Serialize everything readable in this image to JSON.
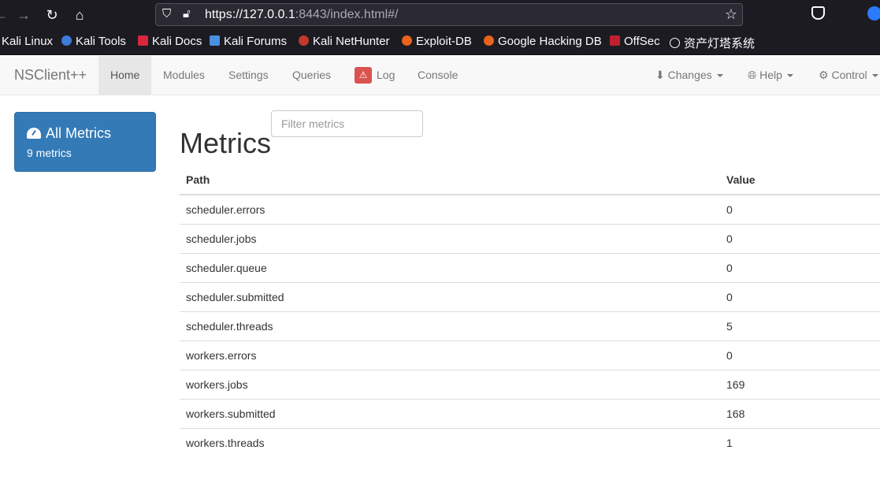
{
  "browser": {
    "url_host": "https://127.0.0.1",
    "url_rest": ":8443/index.html#/",
    "bookmarks": [
      "Kali Linux",
      "Kali Tools",
      "Kali Docs",
      "Kali Forums",
      "Kali NetHunter",
      "Exploit-DB",
      "Google Hacking DB",
      "OffSec",
      "资产灯塔系统"
    ]
  },
  "navbar": {
    "brand": "NSClient++",
    "items": [
      "Home",
      "Modules",
      "Settings",
      "Queries",
      "Log",
      "Console"
    ],
    "active": "Home",
    "right_items": [
      "Changes",
      "Help",
      "Control"
    ]
  },
  "sidebar": {
    "title": "All Metrics",
    "subtitle": "9 metrics"
  },
  "filter": {
    "placeholder": "Filter metrics"
  },
  "main": {
    "title": "Metrics",
    "columns": [
      "Path",
      "Value"
    ],
    "rows": [
      {
        "path": "scheduler.errors",
        "value": "0"
      },
      {
        "path": "scheduler.jobs",
        "value": "0"
      },
      {
        "path": "scheduler.queue",
        "value": "0"
      },
      {
        "path": "scheduler.submitted",
        "value": "0"
      },
      {
        "path": "scheduler.threads",
        "value": "5"
      },
      {
        "path": "workers.errors",
        "value": "0"
      },
      {
        "path": "workers.jobs",
        "value": "169"
      },
      {
        "path": "workers.submitted",
        "value": "168"
      },
      {
        "path": "workers.threads",
        "value": "1"
      }
    ]
  },
  "colors": {
    "accent": "#337ab7",
    "log_badge": "#d9534f"
  }
}
